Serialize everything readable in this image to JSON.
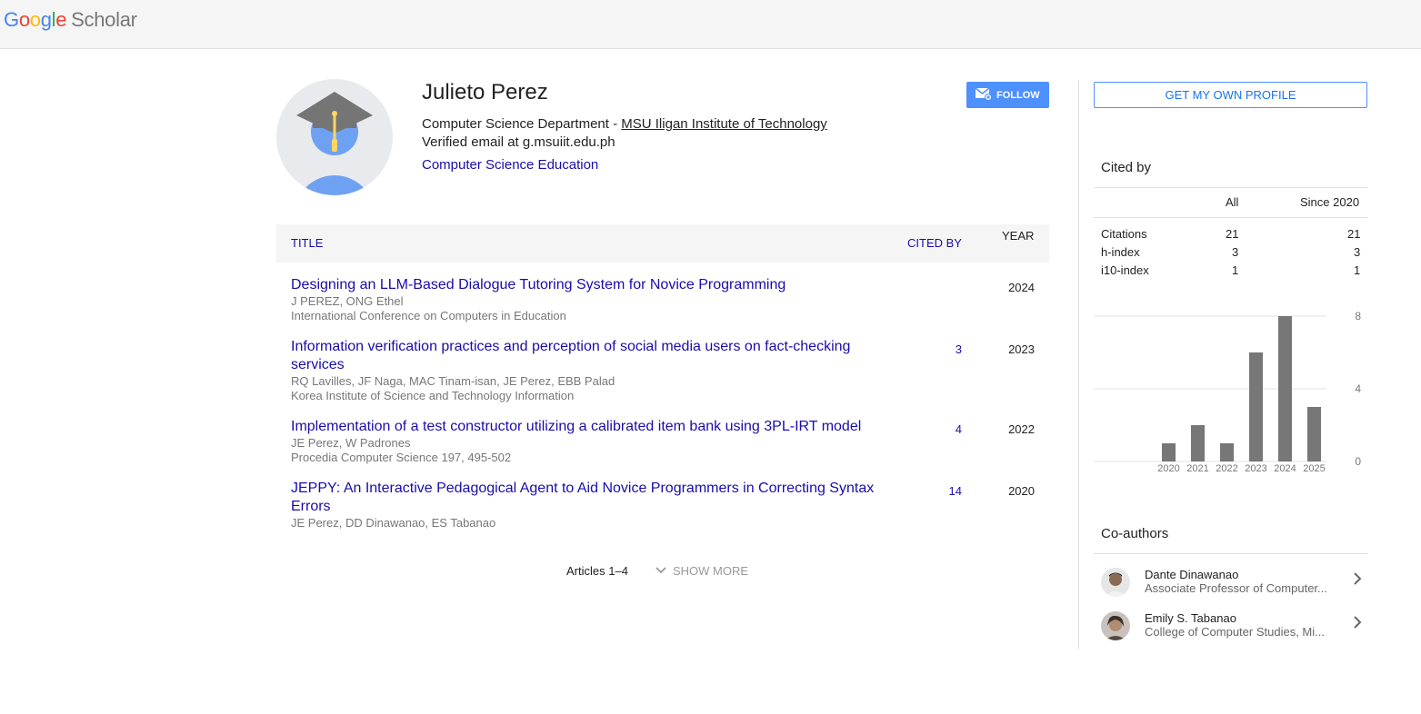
{
  "header": {
    "logo_google": [
      "G",
      "o",
      "o",
      "g",
      "l",
      "e"
    ],
    "logo_scholar": "Scholar"
  },
  "profile": {
    "name": "Julieto Perez",
    "affiliation_prefix": "Computer Science Department - ",
    "affiliation_link": "MSU Iligan Institute of Technology",
    "email": "Verified email at g.msuiit.edu.ph",
    "interest": "Computer Science Education",
    "follow_label": "FOLLOW"
  },
  "table": {
    "col_title": "TITLE",
    "col_cited": "CITED BY",
    "col_year": "YEAR",
    "articles": [
      {
        "title": "Designing an LLM-Based Dialogue Tutoring System for Novice Programming",
        "authors": "J PEREZ, ONG Ethel",
        "venue": "International Conference on Computers in Education",
        "cited": "",
        "year": "2024"
      },
      {
        "title": "Information verification practices and perception of social media users on fact-checking services",
        "authors": "RQ Lavilles, JF Naga, MAC Tinam-isan, JE Perez, EBB Palad",
        "venue": "Korea Institute of Science and Technology Information",
        "cited": "3",
        "year": "2023"
      },
      {
        "title": "Implementation of a test constructor utilizing a calibrated item bank using 3PL-IRT model",
        "authors": "JE Perez, W Padrones",
        "venue": "Procedia Computer Science 197, 495-502",
        "cited": "4",
        "year": "2022"
      },
      {
        "title": "JEPPY: An Interactive Pedagogical Agent to Aid Novice Programmers in Correcting Syntax Errors",
        "authors": "JE Perez, DD Dinawanao, ES Tabanao",
        "venue": "",
        "cited": "14",
        "year": "2020"
      }
    ],
    "pager": "Articles 1–4",
    "show_more": "SHOW MORE"
  },
  "sidebar": {
    "get_profile": "GET MY OWN PROFILE",
    "cited_by_heading": "Cited by",
    "col_all": "All",
    "col_since": "Since 2020",
    "metrics": [
      {
        "label": "Citations",
        "all": "21",
        "since": "21"
      },
      {
        "label": "h-index",
        "all": "3",
        "since": "3"
      },
      {
        "label": "i10-index",
        "all": "1",
        "since": "1"
      }
    ],
    "coauthors_heading": "Co-authors",
    "coauthors": [
      {
        "name": "Dante Dinawanao",
        "affiliation": "Associate Professor of Computer..."
      },
      {
        "name": "Emily S. Tabanao",
        "affiliation": "College of Computer Studies, Mi..."
      }
    ]
  },
  "chart_data": {
    "type": "bar",
    "categories": [
      "2020",
      "2021",
      "2022",
      "2023",
      "2024",
      "2025"
    ],
    "values": [
      1,
      2,
      1,
      6,
      8,
      3
    ],
    "yticks": [
      "0",
      "4",
      "8"
    ],
    "ylim": [
      0,
      8
    ],
    "bar_color": "#777777"
  },
  "colors": {
    "link": "#1a0dab",
    "accent": "#4d90fe"
  }
}
